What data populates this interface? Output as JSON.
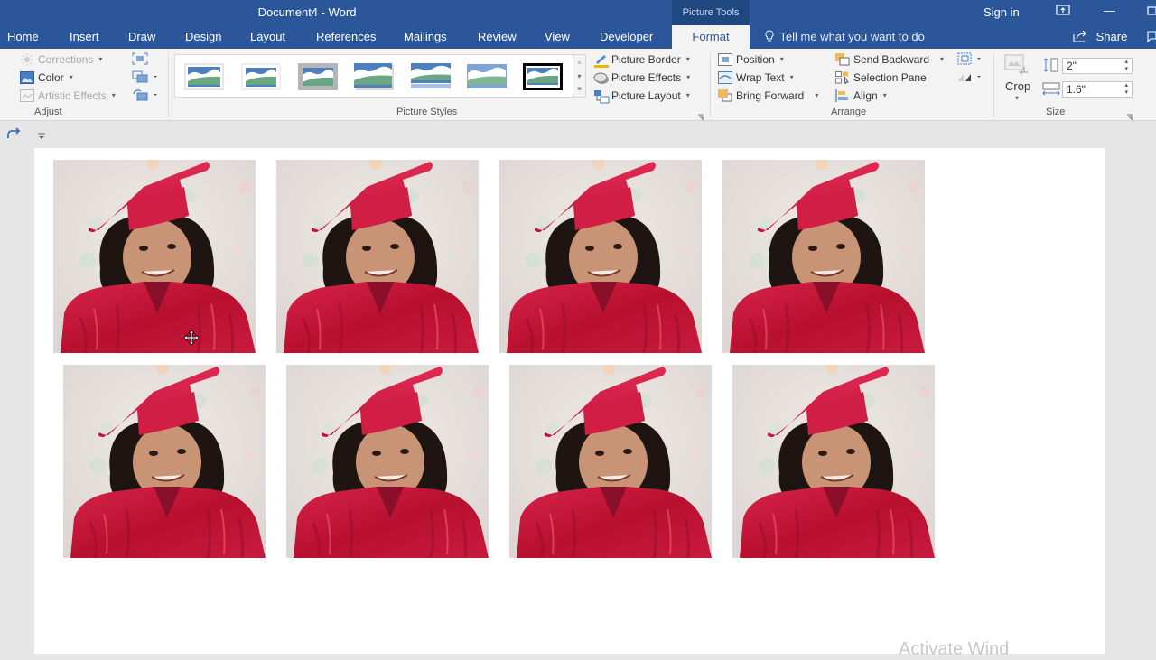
{
  "window": {
    "title": "Document4  -  Word",
    "context_tools": "Picture Tools",
    "sign_in": "Sign in",
    "minimize_glyph": "—"
  },
  "tabs": [
    {
      "label": "Home"
    },
    {
      "label": "Insert"
    },
    {
      "label": "Draw"
    },
    {
      "label": "Design"
    },
    {
      "label": "Layout"
    },
    {
      "label": "References"
    },
    {
      "label": "Mailings"
    },
    {
      "label": "Review"
    },
    {
      "label": "View"
    },
    {
      "label": "Developer"
    },
    {
      "label": "Format",
      "active": true
    }
  ],
  "tell_me": "Tell me what you want to do",
  "share": "Share",
  "ribbon": {
    "adjust": {
      "label": "Adjust",
      "corrections": "Corrections",
      "color": "Color",
      "artistic_effects": "Artistic Effects"
    },
    "picture_styles": {
      "label": "Picture Styles",
      "picture_border": "Picture Border",
      "picture_effects": "Picture Effects",
      "picture_layout": "Picture Layout",
      "style_count": 7
    },
    "arrange": {
      "label": "Arrange",
      "position": "Position",
      "wrap_text": "Wrap Text",
      "bring_forward": "Bring Forward",
      "send_backward": "Send Backward",
      "selection_pane": "Selection Pane",
      "align": "Align"
    },
    "size": {
      "label": "Size",
      "crop": "Crop",
      "height": "2\"",
      "width": "1.6\""
    }
  },
  "document": {
    "photo_count": 8,
    "photo_description": "Child in red graduation cap and gown",
    "colors": {
      "gown": "#c8163e",
      "background": "#e8e4e2",
      "hair": "#1e1512",
      "skin": "#c99375"
    }
  },
  "watermark": "Activate Wind"
}
